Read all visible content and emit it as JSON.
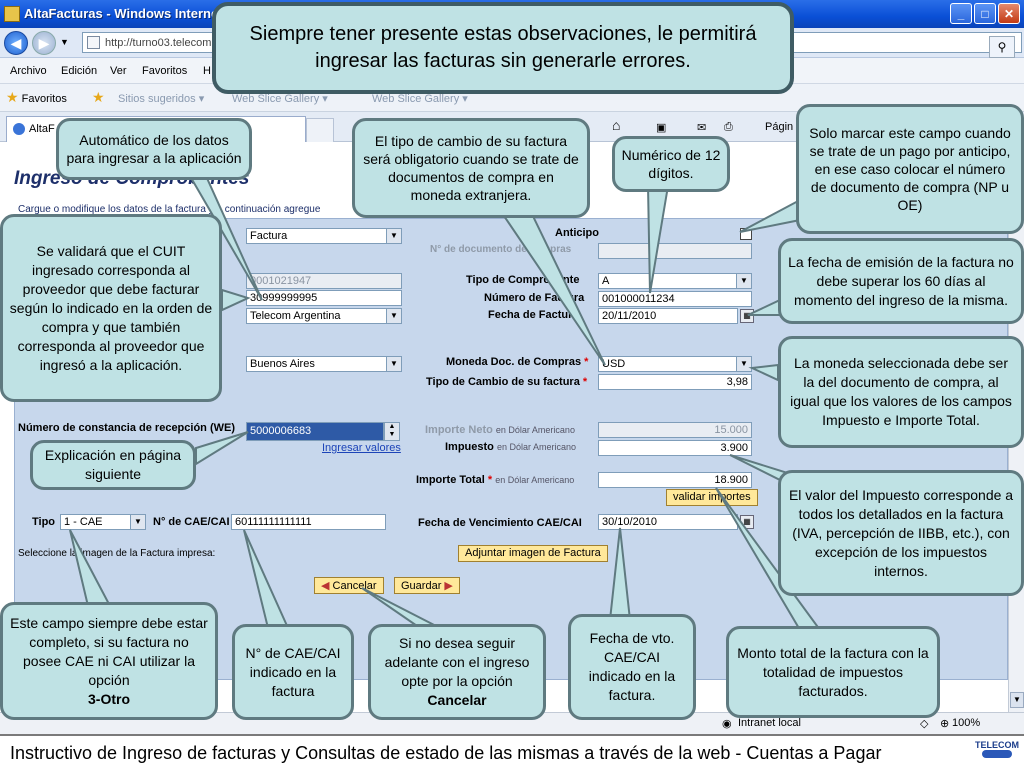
{
  "window": {
    "title": "AltaFacturas - Windows Internet Explorer",
    "url": "http://turno03.telecom",
    "controls": {
      "minimize": "_",
      "maximize": "□",
      "close": "✕"
    }
  },
  "menu": [
    "Archivo",
    "Edición",
    "Ver",
    "Favoritos",
    "H"
  ],
  "favorites_bar": {
    "favoritos": "Favoritos",
    "sugeridos": "Sitios sugeridos ▾",
    "gallery1": "Web Slice Gallery ▾",
    "gallery2": "Web Slice Gallery ▾"
  },
  "tab": {
    "label": "AltaF"
  },
  "commands": {
    "pagina": "Págin"
  },
  "page": {
    "header": "Ingreso de Comprobantes",
    "subtitle": "Cargue o modifique los datos de la factura y a continuación agregue"
  },
  "form": {
    "anticipo_label": "Anticipo",
    "nro_documento_compras_label": "N° de documento de compras",
    "proveedor_tipo": "Factura",
    "codigo": "0001021947",
    "cuit": "30999999995",
    "proveedor": "Telecom Argentina",
    "provincia": "Buenos Aires",
    "tipo_comprobante_label": "Tipo de Comprobante",
    "tipo_comprobante": "A",
    "numero_factura_label": "Número de Factura",
    "numero_factura": "001000011234",
    "fecha_factura_label": "Fecha de Factura",
    "fecha_factura": "20/11/2010",
    "moneda_label": "Moneda Doc. de Compras",
    "moneda": "USD",
    "tipo_cambio_label": "Tipo de Cambio de su factura",
    "tipo_cambio": "3,98",
    "constancia_label": "Número de constancia de recepción (WE)",
    "constancia": "5000006683",
    "ingresar_valores": "Ingresar valores",
    "importe_neto_label": "Importe Neto",
    "importe_neto": "15.000",
    "impuesto_label": "Impuesto",
    "impuesto": "3.900",
    "importe_total_label": "Importe Total",
    "importe_total": "18.900",
    "currency_note": "en Dólar Americano",
    "validar_importes": "validar importes",
    "tipo_label": "Tipo",
    "tipo": "1 - CAE",
    "cae_label": "N° de CAE/CAI",
    "cae": "60111111111111",
    "fecha_vto_label": "Fecha de Vencimiento CAE/CAI",
    "fecha_vto": "30/10/2010",
    "imagen_label": "Seleccione la imagen de la Factura impresa:",
    "adjuntar": "Adjuntar imagen de Factura",
    "cancelar": "Cancelar",
    "guardar": "Guardar"
  },
  "status": {
    "zone": "Intranet local",
    "zoom": "100%"
  },
  "footer": {
    "text": "Instructivo de Ingreso de facturas y Consultas de estado de las mismas a través de la web   -   Cuentas a Pagar",
    "logo": "TELECOM"
  },
  "callouts": {
    "main": "Siempre tener presente estas observaciones, le permitirá ingresar las facturas sin generarle errores.",
    "automatico": "Automático de los datos para ingresar a la aplicación",
    "tipo_cambio": "El tipo de cambio de su factura será obligatorio cuando se trate de documentos de compra en moneda extranjera.",
    "numerico": "Numérico de 12 dígitos.",
    "anticipo": "Solo marcar este campo cuando se trate de un pago por anticipo, en ese caso colocar el número de documento de compra (NP u OE)",
    "cuit": "Se validará que el CUIT ingresado corresponda al proveedor que debe facturar según lo indicado en la orden de compra y que también corresponda al proveedor que ingresó a la aplicación.",
    "fecha_emision": "La fecha de emisión de la factura no debe superar los 60 días al momento del ingreso de la misma.",
    "moneda": "La moneda seleccionada debe ser la del documento de compra, al igual que los valores de los campos Impuesto e Importe Total.",
    "explicacion": "Explicación en página siguiente",
    "impuesto": "El valor del  Impuesto corresponde a todos los detallados en la factura (IVA, percepción de IIBB, etc.), con excepción  de los impuestos internos.",
    "campo_completo_a": "Este campo siempre debe estar completo, si su factura no posee CAE ni CAI utilizar la opción",
    "campo_completo_b": "3-Otro",
    "nro_cae": "N° de CAE/CAI indicado en la factura",
    "cancelar_a": "Si no desea seguir adelante con el ingreso opte por la opción",
    "cancelar_b": "Cancelar",
    "fecha_vto": "Fecha de vto. CAE/CAI indicado en la factura.",
    "monto_total": "Monto total de la factura con la totalidad de impuestos facturados."
  }
}
